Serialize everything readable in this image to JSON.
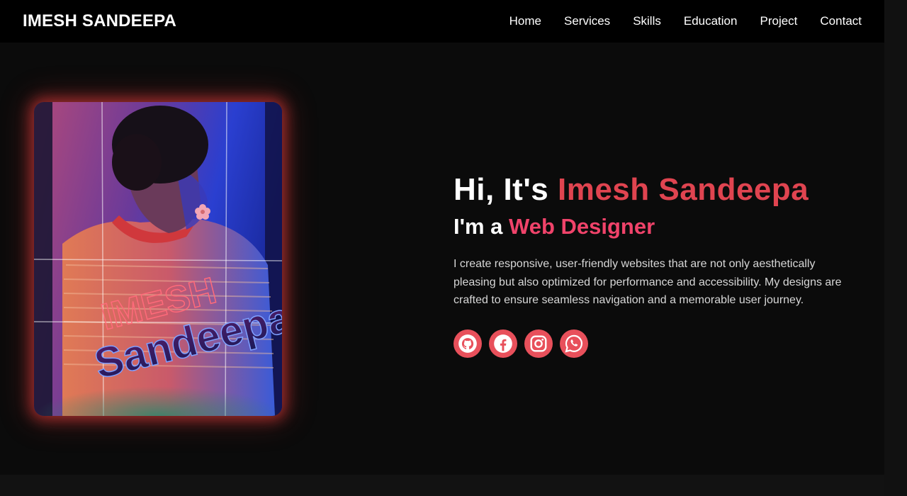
{
  "brand": "IMESH SANDEEPA",
  "nav": {
    "items": [
      "Home",
      "Services",
      "Skills",
      "Education",
      "Project",
      "Contact"
    ]
  },
  "hero": {
    "greeting_prefix": "Hi, It's ",
    "name": "Imesh Sandeepa",
    "role_prefix": "I'm a ",
    "role": "Web Designer",
    "bio": "I create responsive, user-friendly websites that are not only aesthetically pleasing but also optimized for performance and accessibility. My designs are crafted to ensure seamless navigation and a memorable user journey.",
    "photo_text": {
      "line1": "IMESH",
      "line2": "Sandeepa"
    }
  },
  "socials": [
    {
      "icon": "github-icon",
      "label": "GitHub"
    },
    {
      "icon": "facebook-icon",
      "label": "Facebook"
    },
    {
      "icon": "instagram-icon",
      "label": "Instagram"
    },
    {
      "icon": "whatsapp-icon",
      "label": "WhatsApp"
    }
  ],
  "colors": {
    "accent_name": "#e04450",
    "accent_role": "#f0436a",
    "social_bg": "#e8505b",
    "glow": "#e63c3c",
    "background": "#0b0b0b",
    "navbar": "#000000"
  }
}
